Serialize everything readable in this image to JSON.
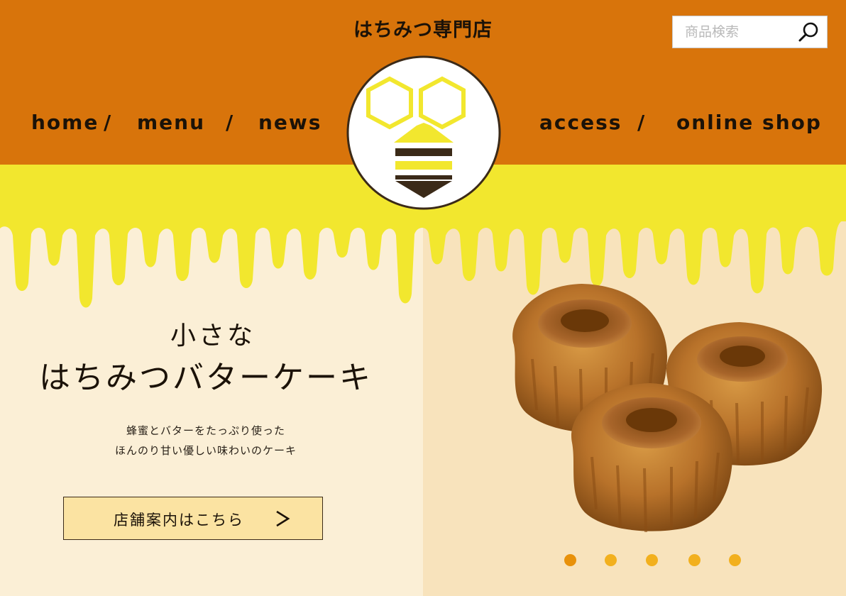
{
  "header": {
    "store_name": "はちみつ専門店",
    "search": {
      "placeholder": "商品検索",
      "value": ""
    }
  },
  "nav": {
    "left": [
      {
        "label": "home"
      },
      {
        "label": "menu"
      },
      {
        "label": "news"
      }
    ],
    "right": [
      {
        "label": "access"
      },
      {
        "label": "online shop"
      }
    ],
    "separator": "/"
  },
  "hero": {
    "headline_small": "小さな",
    "headline_large": "はちみつバターケーキ",
    "description_lines": [
      "蜂蜜とバターをたっぷり使った",
      "ほんのり甘い優しい味わいのケーキ"
    ],
    "button_label": "店舗案内はこちら",
    "carousel": {
      "count": 5,
      "active_index": 0
    }
  },
  "colors": {
    "header_orange": "#d8740b",
    "honey_yellow": "#f2e72e",
    "cream": "#fbefd6",
    "dark_brown": "#3b2a18",
    "dot": "#f2b01e",
    "dot_active": "#e8910a"
  },
  "icons": {
    "search": "search-icon",
    "arrow": "chevron-right-icon",
    "logo": "bee-honeycomb-logo"
  }
}
